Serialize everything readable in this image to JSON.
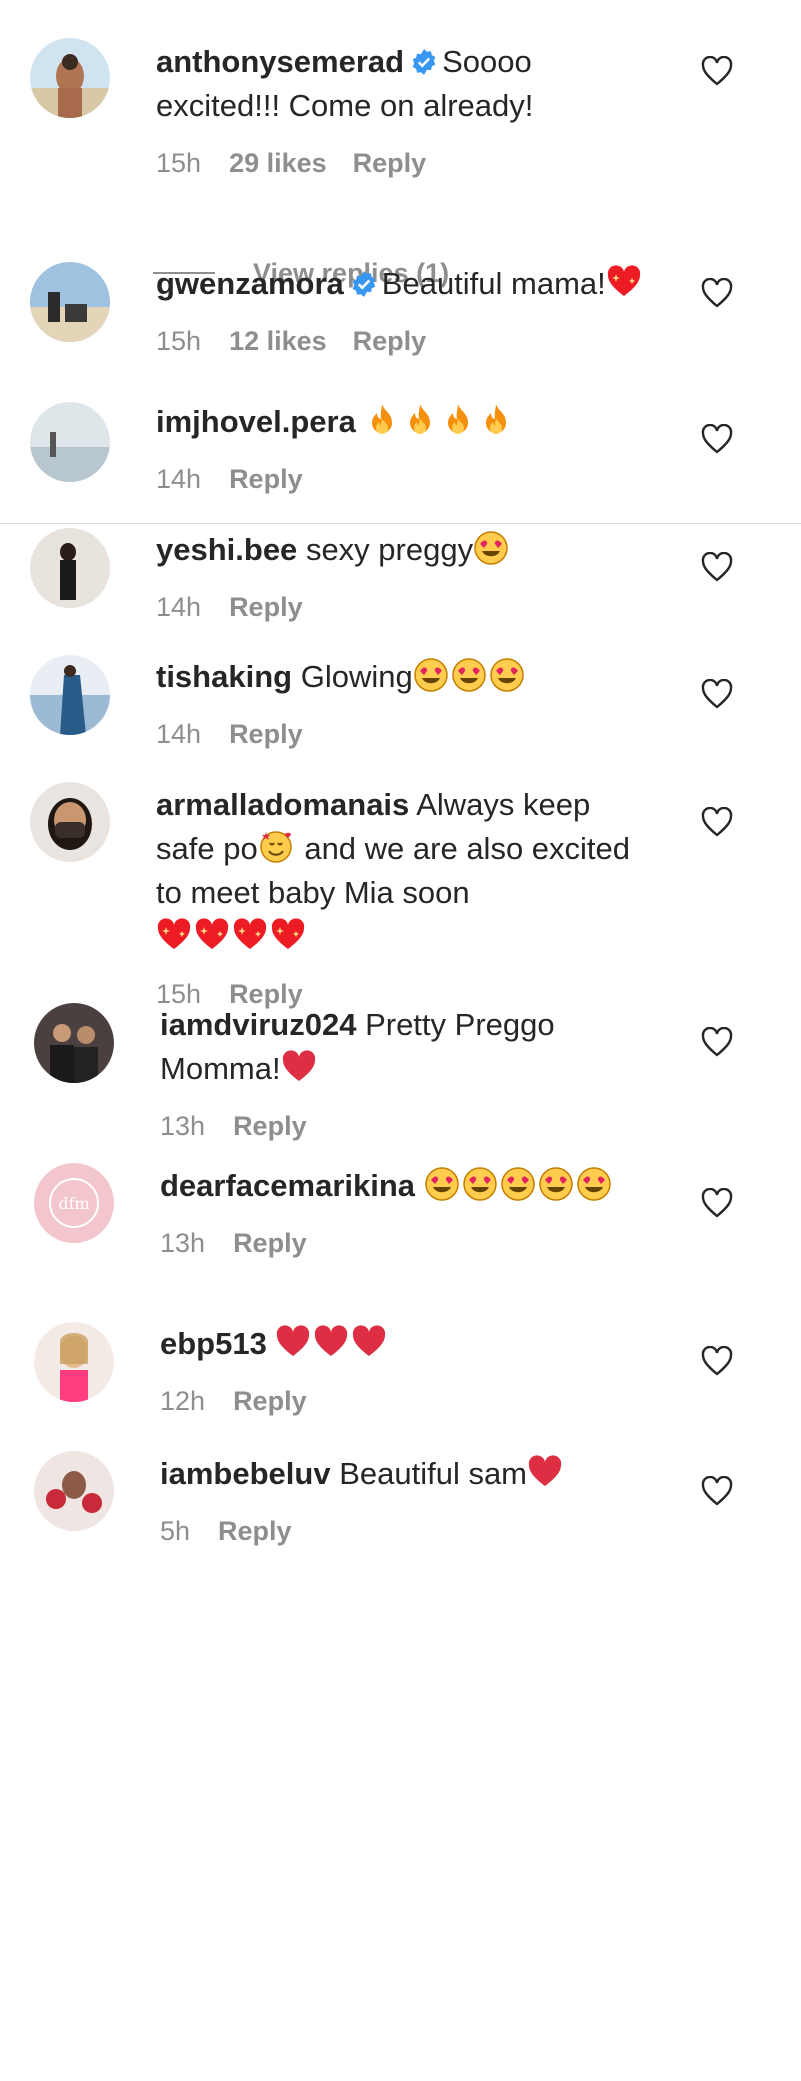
{
  "comments": [
    {
      "user": "anthonysemerad",
      "verified": true,
      "text": "Soooo excited!!! Come on already!",
      "emojis": [],
      "time": "15h",
      "likes": "29 likes",
      "reply": "Reply",
      "avatar": "beach-man"
    },
    {
      "user": "gwenzamora",
      "verified": true,
      "text": "Beautiful mama!",
      "emojis": [
        "sparkling-heart"
      ],
      "time": "15h",
      "likes": "12 likes",
      "reply": "Reply",
      "avatar": "beach-couple"
    },
    {
      "user": "imjhovel.pera",
      "verified": false,
      "text": "",
      "emojis": [
        "fire",
        "fire",
        "fire",
        "fire"
      ],
      "time": "14h",
      "likes": "",
      "reply": "Reply",
      "avatar": "lake"
    },
    {
      "user": "yeshi.bee",
      "verified": false,
      "text": "sexy preggy",
      "emojis": [
        "heart-eyes"
      ],
      "time": "14h",
      "likes": "",
      "reply": "Reply",
      "avatar": "figure-dark"
    },
    {
      "user": "tishaking",
      "verified": false,
      "text": "Glowing",
      "emojis": [
        "heart-eyes",
        "heart-eyes",
        "heart-eyes"
      ],
      "time": "14h",
      "likes": "",
      "reply": "Reply",
      "avatar": "ocean-person"
    },
    {
      "user": "armalladomanais",
      "verified": false,
      "text": "Always keep safe po",
      "text2": "and we are also excited to meet baby Mia soon",
      "emojis": [
        "smiling-hearts"
      ],
      "emojis2": [
        "sparkling-heart",
        "sparkling-heart",
        "sparkling-heart",
        "sparkling-heart"
      ],
      "time": "15h",
      "likes": "",
      "reply": "Reply",
      "avatar": "masked"
    },
    {
      "user": "iamdviruz024",
      "verified": false,
      "text": "Pretty Preggo Momma!",
      "emojis": [
        "red-heart"
      ],
      "time": "13h",
      "likes": "",
      "reply": "Reply",
      "avatar": "group"
    },
    {
      "user": "dearfacemarikina",
      "verified": false,
      "text": "",
      "emojis": [
        "heart-eyes",
        "heart-eyes",
        "heart-eyes",
        "heart-eyes",
        "heart-eyes"
      ],
      "time": "13h",
      "likes": "",
      "reply": "Reply",
      "avatar": "pink-logo"
    },
    {
      "user": "ebp513",
      "verified": false,
      "text": "",
      "emojis": [
        "red-heart",
        "red-heart",
        "red-heart"
      ],
      "time": "12h",
      "likes": "",
      "reply": "Reply",
      "avatar": "woman-pink"
    },
    {
      "user": "iambebeluv",
      "verified": false,
      "text": "Beautiful sam",
      "emojis": [
        "red-heart"
      ],
      "time": "5h",
      "likes": "",
      "reply": "Reply",
      "avatar": "roses"
    }
  ],
  "view_replies": "View replies (1)",
  "colors": {
    "text": "#262626",
    "muted": "#8e8e8e",
    "verified": "#3897f0",
    "red": "#ed1c24",
    "fire": "#f7931e"
  }
}
